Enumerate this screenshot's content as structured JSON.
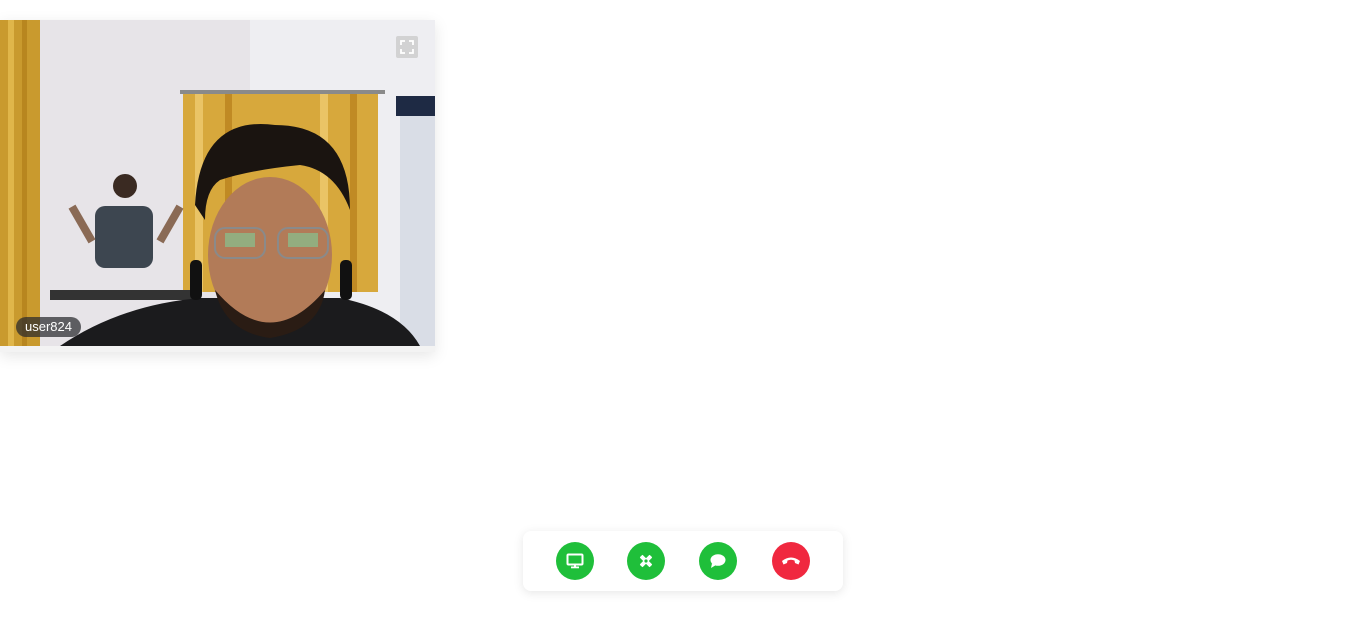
{
  "participants": [
    {
      "name": "user824"
    }
  ],
  "tile": {
    "fullscreen_icon": "expand-icon"
  },
  "controls": [
    {
      "id": "share-screen",
      "icon": "monitor-icon",
      "color": "#1fbf3a"
    },
    {
      "id": "whiteboard",
      "icon": "pencil-ruler-icon",
      "color": "#1fbf3a"
    },
    {
      "id": "chat",
      "icon": "chat-bubble-icon",
      "color": "#1fbf3a"
    },
    {
      "id": "end-call",
      "icon": "phone-hangup-icon",
      "color": "#f0283f"
    }
  ],
  "colors": {
    "accent_green": "#1fbf3a",
    "danger_red": "#f0283f",
    "name_tag_bg": "#2a2a2f"
  }
}
